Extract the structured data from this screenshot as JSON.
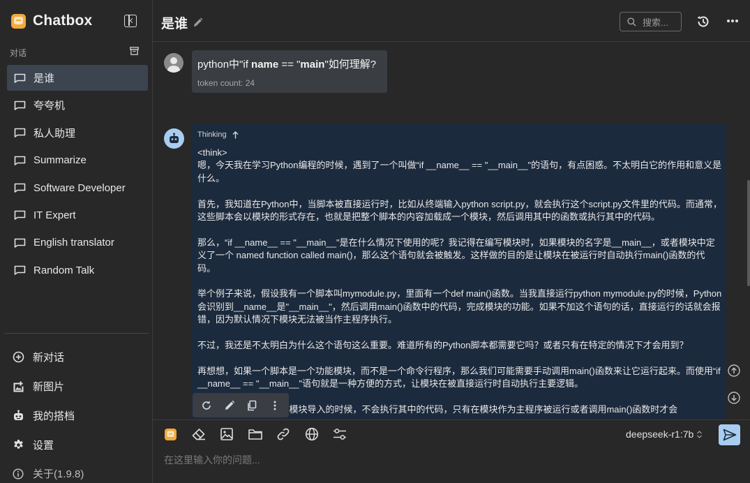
{
  "app": {
    "name": "Chatbox",
    "version_label": "关于(1.9.8)"
  },
  "sidebar": {
    "section_label": "对话",
    "conversations": [
      {
        "label": "是谁",
        "active": true
      },
      {
        "label": "夸夸机"
      },
      {
        "label": "私人助理"
      },
      {
        "label": "Summarize"
      },
      {
        "label": "Software Developer"
      },
      {
        "label": "IT Expert"
      },
      {
        "label": "English translator"
      },
      {
        "label": "Random Talk"
      }
    ],
    "actions": {
      "new_chat": "新对话",
      "new_image": "新图片",
      "my_copilots": "我的搭档",
      "settings": "设置"
    }
  },
  "header": {
    "title": "是谁",
    "search_placeholder": "搜索..."
  },
  "messages": {
    "user": {
      "question_prefix": "python中\"if ",
      "question_bold1": "name",
      "question_mid": " == \"",
      "question_bold2": "main",
      "question_suffix": "\"如何理解?",
      "token_count": "token count: 24"
    },
    "assistant": {
      "thinking_label": "Thinking",
      "think_tag": "<think>",
      "paragraphs": [
        "嗯，今天我在学习Python编程的时候，遇到了一个叫做“if __name__ == \"__main__\"的语句，有点困惑。不太明白它的作用和意义是什么。",
        "首先，我知道在Python中，当脚本被直接运行时，比如从终端输入python script.py，就会执行这个script.py文件里的代码。而通常，这些脚本会以模块的形式存在，也就是把整个脚本的内容加载成一个模块，然后调用其中的函数或执行其中的代码。",
        "那么，“if __name__ == \"__main__\"是在什么情况下使用的呢？我记得在编写模块时，如果模块的名字是__main__，或者模块中定义了一个 named function called main()，那么这个语句就会被触发。这样做的目的是让模块在被运行时自动执行main()函数的代码。",
        "举个例子来说，假设我有一个脚本叫mymodule.py，里面有一个def main()函数。当我直接运行python mymodule.py的时候，Python会识别到__name__是\"__main__\"，然后调用main()函数中的代码，完成模块的功能。如果不加这个语句的话，直接运行的话就会报错，因为默认情况下模块无法被当作主程序执行。",
        "不过，我还是不太明白为什么这个语句这么重要。难道所有的Python脚本都需要它吗？或者只有在特定的情况下才会用到？",
        "再想想，如果一个脚本是一个功能模块，而不是一个命令行程序，那么我们可能需要手动调用main()函数来让它运行起来。而使用“if __name__ == \"__main__\"语句就是一种方便的方式，让模块在被直接运行时自动执行主要逻辑。",
        "另外，在Python中，当模块导入的时候，不会执行其中的代码，只有在模块作为主程序被运行或者调用main()函数时才会"
      ]
    }
  },
  "composer": {
    "model": "deepseek-r1:7b",
    "placeholder": "在这里输入你的问题..."
  }
}
